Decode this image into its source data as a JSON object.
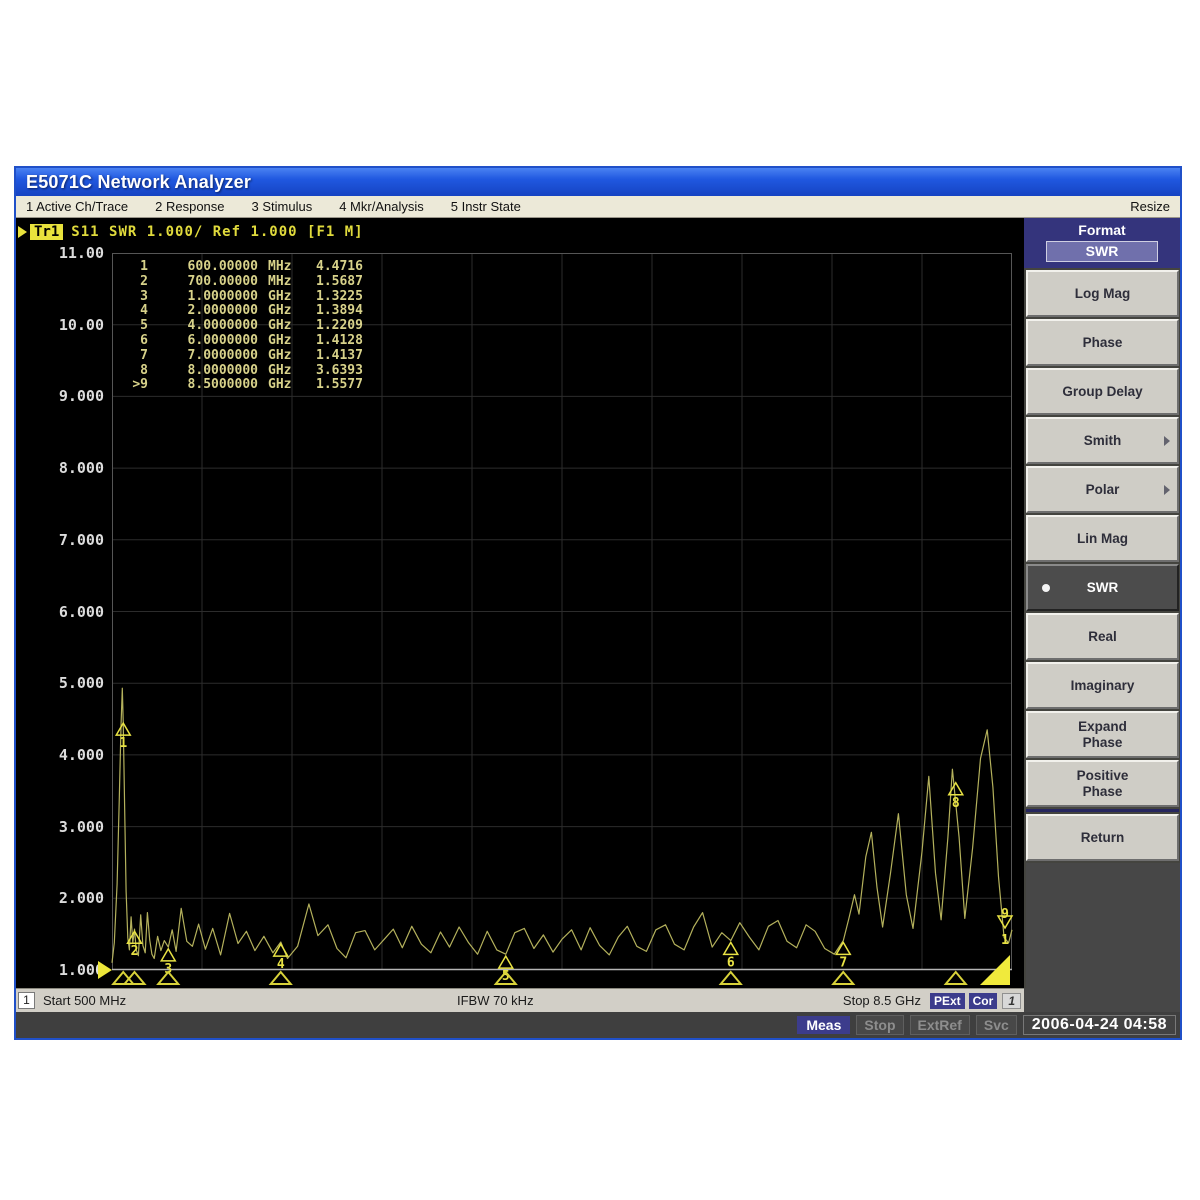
{
  "window": {
    "title": "E5071C Network Analyzer",
    "resize_label": "Resize"
  },
  "menu": {
    "items": [
      "1 Active Ch/Trace",
      "2 Response",
      "3 Stimulus",
      "4 Mkr/Analysis",
      "5 Instr State"
    ]
  },
  "trace_status": {
    "trace": "Tr1",
    "text": "S11 SWR 1.000/ Ref 1.000 [F1 M]"
  },
  "sidebar": {
    "header": {
      "title": "Format",
      "value": "SWR"
    },
    "buttons": [
      {
        "label": "Log Mag"
      },
      {
        "label": "Phase"
      },
      {
        "label": "Group Delay"
      },
      {
        "label": "Smith",
        "submenu": true
      },
      {
        "label": "Polar",
        "submenu": true
      },
      {
        "label": "Lin Mag"
      },
      {
        "label": "SWR",
        "selected": true
      },
      {
        "label": "Real"
      },
      {
        "label": "Imaginary"
      },
      {
        "label": "Expand\nPhase"
      },
      {
        "label": "Positive\nPhase"
      },
      {
        "label": "Return",
        "separator": true
      }
    ]
  },
  "status_bar": {
    "channel": "1",
    "start": "Start 500 MHz",
    "ifbw": "IFBW 70 kHz",
    "stop": "Stop 8.5 GHz",
    "badges": [
      "PExt",
      "Cor"
    ],
    "indicator": "1"
  },
  "bottom_bar": {
    "meas": "Meas",
    "stop": "Stop",
    "extref": "ExtRef",
    "svc": "Svc",
    "datetime": "2006-04-24 04:58"
  },
  "colors": {
    "trace": "#b4b15c",
    "marker": "#e8e244",
    "grid": "#2c2c2c",
    "plot_border": "#565656",
    "axis_line": "#b5b5b5",
    "table_text": "#d8d28a",
    "accent_navy": "#3c3c8c",
    "title_blue": "#2058e0"
  },
  "chart_data": {
    "type": "line",
    "title": "Tr1 S11 SWR 1.000/ Ref 1.000 [F1 M]",
    "xlabel": "Frequency",
    "ylabel": "SWR",
    "x_start_ghz": 0.5,
    "x_stop_ghz": 8.5,
    "ylim": [
      1,
      11
    ],
    "x_divisions": 10,
    "grid": true,
    "ytick_labels": [
      "11.00",
      "10.00",
      "9.000",
      "8.000",
      "7.000",
      "6.000",
      "5.000",
      "4.000",
      "3.000",
      "2.000",
      "1.000"
    ],
    "marker_table": {
      "rows": [
        [
          "1",
          "600.00000",
          "MHz",
          "4.4716"
        ],
        [
          "2",
          "700.00000",
          "MHz",
          "1.5687"
        ],
        [
          "3",
          "1.0000000",
          "GHz",
          "1.3225"
        ],
        [
          "4",
          "2.0000000",
          "GHz",
          "1.3894"
        ],
        [
          "5",
          "4.0000000",
          "GHz",
          "1.2209"
        ],
        [
          "6",
          "6.0000000",
          "GHz",
          "1.4128"
        ],
        [
          "7",
          "7.0000000",
          "GHz",
          "1.4137"
        ],
        [
          "8",
          "8.0000000",
          "GHz",
          "3.6393"
        ],
        [
          ">9",
          "8.5000000",
          "GHz",
          "1.5577"
        ]
      ]
    },
    "markers": [
      {
        "n": "1",
        "freq_ghz": 0.6,
        "value": 4.4716
      },
      {
        "n": "2",
        "freq_ghz": 0.7,
        "value": 1.5687
      },
      {
        "n": "3",
        "freq_ghz": 1.0,
        "value": 1.3225
      },
      {
        "n": "4",
        "freq_ghz": 2.0,
        "value": 1.3894
      },
      {
        "n": "5",
        "freq_ghz": 4.0,
        "value": 1.2209
      },
      {
        "n": "6",
        "freq_ghz": 6.0,
        "value": 1.4128
      },
      {
        "n": "7",
        "freq_ghz": 7.0,
        "value": 1.4137
      },
      {
        "n": "8",
        "freq_ghz": 8.0,
        "value": 3.6393
      },
      {
        "n": "9",
        "freq_ghz": 8.5,
        "value": 1.5577,
        "active": true,
        "sub_label": "1"
      }
    ],
    "series": [
      {
        "name": "Tr1 S11 SWR",
        "points": [
          [
            0.5,
            1.1
          ],
          [
            0.52,
            1.38
          ],
          [
            0.545,
            2.2
          ],
          [
            0.565,
            3.4
          ],
          [
            0.58,
            4.4
          ],
          [
            0.592,
            4.93
          ],
          [
            0.6,
            4.47
          ],
          [
            0.612,
            3.3
          ],
          [
            0.625,
            2.1
          ],
          [
            0.64,
            1.45
          ],
          [
            0.655,
            1.28
          ],
          [
            0.67,
            1.74
          ],
          [
            0.685,
            1.38
          ],
          [
            0.7,
            1.57
          ],
          [
            0.715,
            1.28
          ],
          [
            0.735,
            1.2
          ],
          [
            0.755,
            1.77
          ],
          [
            0.775,
            1.34
          ],
          [
            0.795,
            1.24
          ],
          [
            0.815,
            1.8
          ],
          [
            0.835,
            1.42
          ],
          [
            0.855,
            1.22
          ],
          [
            0.875,
            1.16
          ],
          [
            0.905,
            1.47
          ],
          [
            0.935,
            1.27
          ],
          [
            0.965,
            1.41
          ],
          [
            1.0,
            1.32
          ],
          [
            1.035,
            1.56
          ],
          [
            1.07,
            1.26
          ],
          [
            1.115,
            1.86
          ],
          [
            1.165,
            1.4
          ],
          [
            1.215,
            1.33
          ],
          [
            1.27,
            1.64
          ],
          [
            1.33,
            1.29
          ],
          [
            1.395,
            1.58
          ],
          [
            1.465,
            1.21
          ],
          [
            1.545,
            1.79
          ],
          [
            1.62,
            1.37
          ],
          [
            1.695,
            1.54
          ],
          [
            1.77,
            1.27
          ],
          [
            1.85,
            1.47
          ],
          [
            1.93,
            1.24
          ],
          [
            2.0,
            1.39
          ],
          [
            2.06,
            1.16
          ],
          [
            2.15,
            1.33
          ],
          [
            2.25,
            1.92
          ],
          [
            2.33,
            1.48
          ],
          [
            2.42,
            1.63
          ],
          [
            2.5,
            1.3
          ],
          [
            2.58,
            1.17
          ],
          [
            2.665,
            1.52
          ],
          [
            2.75,
            1.55
          ],
          [
            2.835,
            1.28
          ],
          [
            2.92,
            1.43
          ],
          [
            3.0,
            1.57
          ],
          [
            3.08,
            1.31
          ],
          [
            3.165,
            1.61
          ],
          [
            3.25,
            1.36
          ],
          [
            3.335,
            1.24
          ],
          [
            3.42,
            1.53
          ],
          [
            3.5,
            1.32
          ],
          [
            3.585,
            1.6
          ],
          [
            3.67,
            1.38
          ],
          [
            3.75,
            1.22
          ],
          [
            3.835,
            1.54
          ],
          [
            3.92,
            1.28
          ],
          [
            4.0,
            1.22
          ],
          [
            4.08,
            1.52
          ],
          [
            4.165,
            1.58
          ],
          [
            4.25,
            1.3
          ],
          [
            4.335,
            1.49
          ],
          [
            4.42,
            1.25
          ],
          [
            4.5,
            1.43
          ],
          [
            4.585,
            1.56
          ],
          [
            4.67,
            1.28
          ],
          [
            4.75,
            1.59
          ],
          [
            4.835,
            1.34
          ],
          [
            4.92,
            1.21
          ],
          [
            5.0,
            1.46
          ],
          [
            5.08,
            1.61
          ],
          [
            5.165,
            1.33
          ],
          [
            5.25,
            1.26
          ],
          [
            5.335,
            1.56
          ],
          [
            5.42,
            1.63
          ],
          [
            5.5,
            1.36
          ],
          [
            5.585,
            1.28
          ],
          [
            5.67,
            1.6
          ],
          [
            5.75,
            1.8
          ],
          [
            5.835,
            1.32
          ],
          [
            5.92,
            1.52
          ],
          [
            6.0,
            1.41
          ],
          [
            6.08,
            1.66
          ],
          [
            6.165,
            1.46
          ],
          [
            6.25,
            1.28
          ],
          [
            6.335,
            1.61
          ],
          [
            6.42,
            1.69
          ],
          [
            6.5,
            1.4
          ],
          [
            6.585,
            1.31
          ],
          [
            6.67,
            1.63
          ],
          [
            6.75,
            1.54
          ],
          [
            6.835,
            1.3
          ],
          [
            6.92,
            1.22
          ],
          [
            7.0,
            1.41
          ],
          [
            7.05,
            1.72
          ],
          [
            7.1,
            2.05
          ],
          [
            7.14,
            1.78
          ],
          [
            7.2,
            2.58
          ],
          [
            7.25,
            2.92
          ],
          [
            7.3,
            2.15
          ],
          [
            7.35,
            1.6
          ],
          [
            7.42,
            2.35
          ],
          [
            7.49,
            3.18
          ],
          [
            7.56,
            2.05
          ],
          [
            7.62,
            1.58
          ],
          [
            7.7,
            2.65
          ],
          [
            7.76,
            3.7
          ],
          [
            7.82,
            2.35
          ],
          [
            7.87,
            1.7
          ],
          [
            7.93,
            2.85
          ],
          [
            7.97,
            3.8
          ],
          [
            8.03,
            2.85
          ],
          [
            8.08,
            1.72
          ],
          [
            8.15,
            2.7
          ],
          [
            8.22,
            3.95
          ],
          [
            8.28,
            4.35
          ],
          [
            8.33,
            3.55
          ],
          [
            8.38,
            2.3
          ],
          [
            8.43,
            1.45
          ],
          [
            8.47,
            1.38
          ],
          [
            8.5,
            1.56
          ]
        ]
      }
    ]
  }
}
